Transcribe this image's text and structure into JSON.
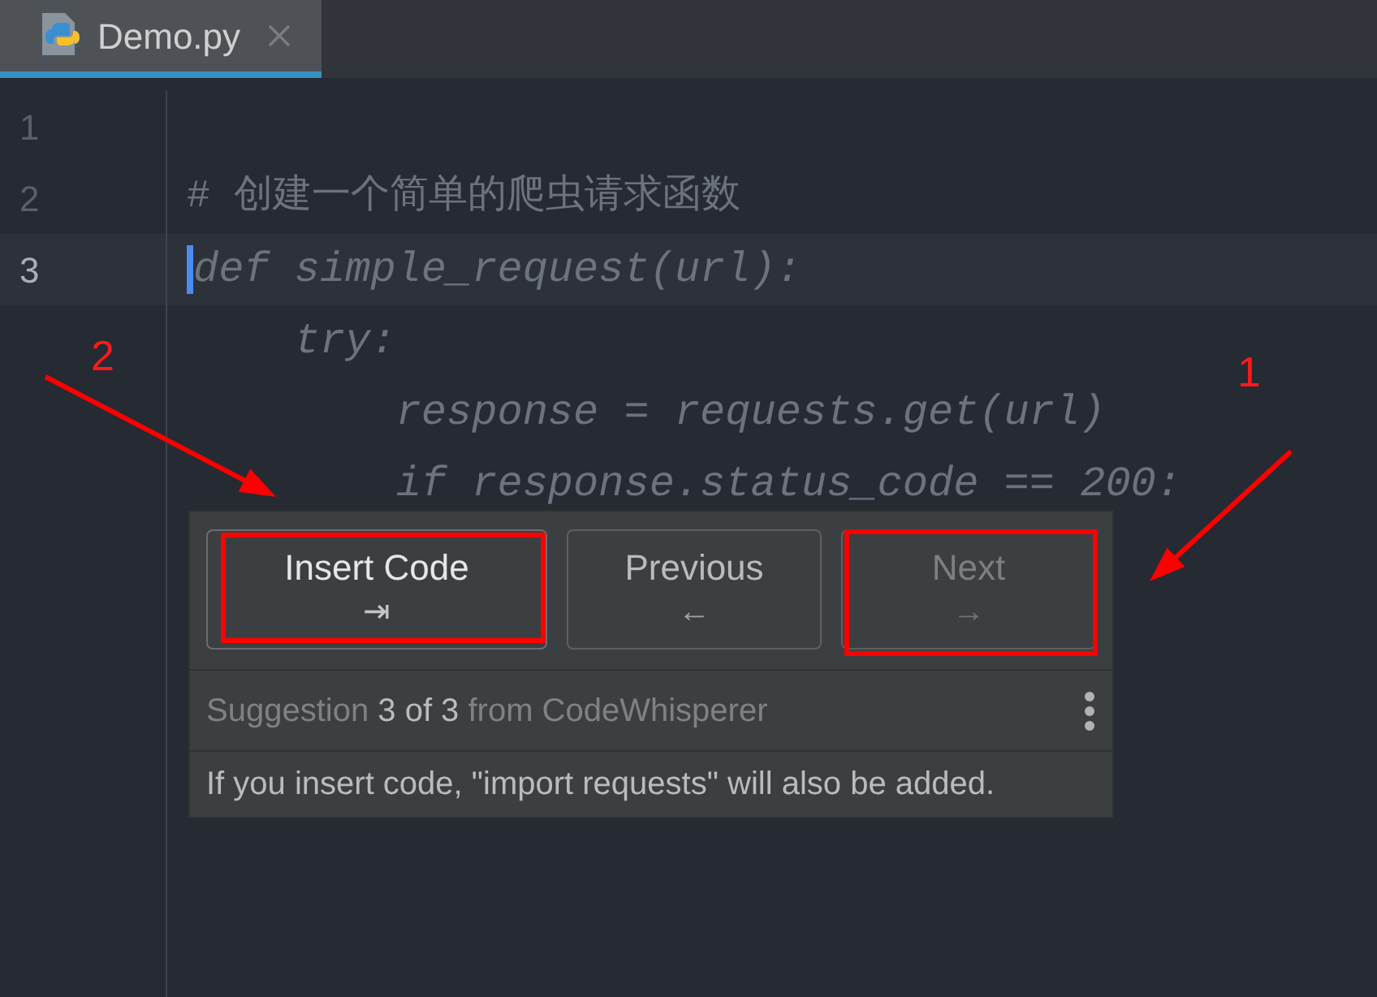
{
  "tabs": [
    {
      "label": "Demo.py",
      "selected": true
    }
  ],
  "gutter": [
    "1",
    "2",
    "3"
  ],
  "lines": [
    {
      "kind": "blank",
      "current": false
    },
    {
      "kind": "comment",
      "text": "# 创建一个简单的爬虫请求函数",
      "current": false
    },
    {
      "kind": "ghost",
      "text": "def simple_request(url):",
      "current": true
    },
    {
      "kind": "ghost",
      "text": "    try:",
      "current": false
    },
    {
      "kind": "ghost",
      "text": "        response = requests.get(url)",
      "current": false
    },
    {
      "kind": "ghost",
      "text": "        if response.status_code == 200:",
      "current": false
    }
  ],
  "popup": {
    "buttons": [
      {
        "label": "Insert Code",
        "shortcut": "⇥",
        "default": true,
        "disabled": false
      },
      {
        "label": "Previous",
        "shortcut": "←",
        "default": false,
        "disabled": false
      },
      {
        "label": "Next",
        "shortcut": "→",
        "default": false,
        "disabled": true
      }
    ],
    "status": "Suggestion **3 of 3** from CodeWhisperer",
    "message": "If you insert code, \"import requests\" will also be added."
  },
  "annotations": [
    {
      "label": "2"
    },
    {
      "label": "1"
    }
  ]
}
